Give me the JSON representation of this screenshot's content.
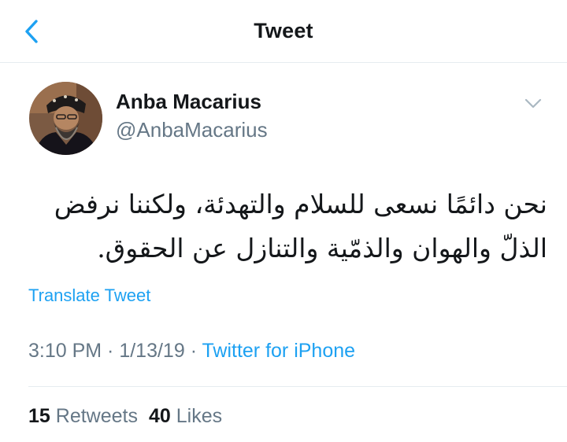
{
  "header": {
    "title": "Tweet",
    "back_icon": "chevron-left-icon"
  },
  "author": {
    "name": "Anba Macarius",
    "handle": "@AnbaMacarius",
    "menu_icon": "chevron-down-icon"
  },
  "tweet": {
    "text_line1": "نحن دائمًا نسعى للسلام والتهدئة، ولكننا نرفض",
    "text_line2": "الذلّ والهوان والذمّية والتنازل عن الحقوق.",
    "translate_label": "Translate Tweet"
  },
  "meta": {
    "time": "3:10 PM",
    "separator": " · ",
    "date": "1/13/19",
    "source": "Twitter for iPhone"
  },
  "stats": {
    "retweets_count": "15",
    "retweets_label": "Retweets",
    "likes_count": "40",
    "likes_label": "Likes"
  },
  "colors": {
    "accent": "#1da1f2",
    "text_primary": "#14171a",
    "text_secondary": "#657786",
    "divider": "#e6ecf0"
  }
}
